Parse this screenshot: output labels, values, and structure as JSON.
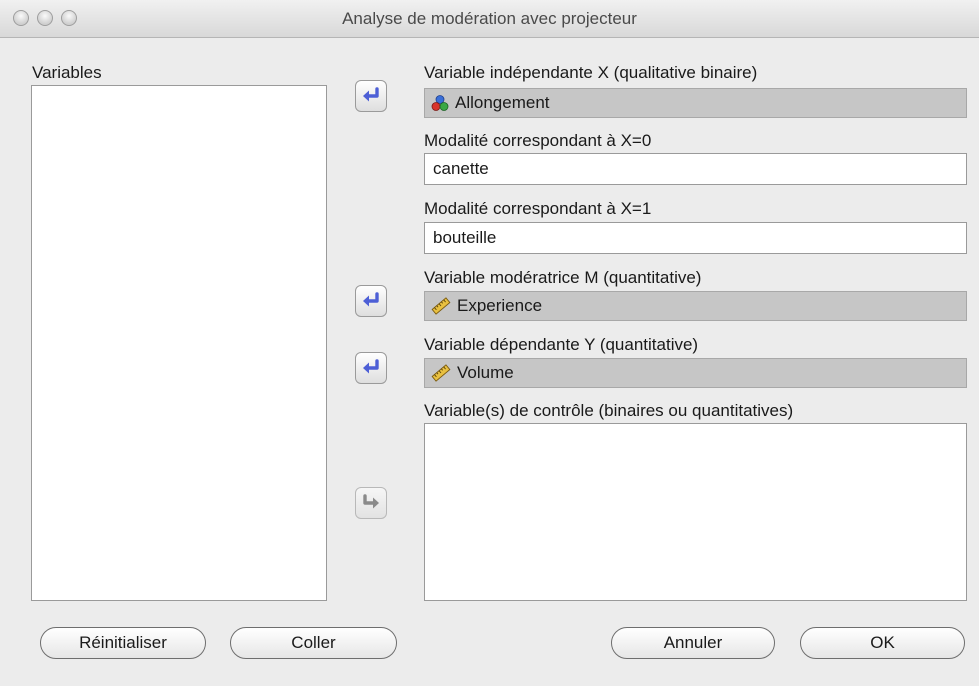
{
  "window": {
    "title": "Analyse de modération avec projecteur"
  },
  "variables_panel": {
    "label": "Variables",
    "items": []
  },
  "x_variable": {
    "label": "Variable indépendante X (qualitative binaire)",
    "value": "Allongement",
    "icon": "nominal-variable-icon"
  },
  "x0_modality": {
    "label": "Modalité correspondant à X=0",
    "value": "canette"
  },
  "x1_modality": {
    "label": "Modalité correspondant à X=1",
    "value": "bouteille"
  },
  "m_variable": {
    "label": "Variable modératrice M (quantitative)",
    "value": "Experience",
    "icon": "ruler-scale-icon"
  },
  "y_variable": {
    "label": "Variable dépendante Y (quantitative)",
    "value": "Volume",
    "icon": "ruler-scale-icon"
  },
  "control_variables": {
    "label": "Variable(s) de contrôle (binaires ou quantitatives)",
    "items": []
  },
  "buttons": {
    "reset": "Réinitialiser",
    "paste": "Coller",
    "cancel": "Annuler",
    "ok": "OK"
  },
  "colors": {
    "arrow_blue": "#4d5fd6",
    "arrow_disabled": "#8a8a8a",
    "field_bg": "#c6c6c6",
    "window_bg": "#ececec"
  }
}
